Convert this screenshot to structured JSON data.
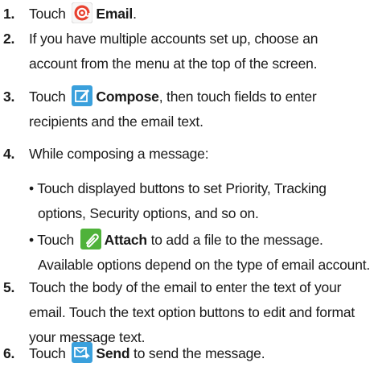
{
  "steps": [
    {
      "num": "1.",
      "pre": "Touch",
      "bold": "Email",
      "post": ".",
      "icon": "email-icon"
    },
    {
      "num": "2.",
      "line1": "If you have multiple accounts set up, choose an",
      "line2": "account from the menu at the top of the screen."
    },
    {
      "num": "3.",
      "pre": "Touch",
      "bold": "Compose",
      "post": ", then touch fields to enter",
      "line2": "recipients and the email text.",
      "icon": "compose-icon"
    },
    {
      "num": "4.",
      "line1": "While composing a message:"
    },
    {
      "num": "5.",
      "line1": "Touch the body of the email to enter the text of your",
      "line2": "email. Touch the text option buttons to edit and format",
      "line3": "your message text."
    },
    {
      "num": "6.",
      "pre": "Touch",
      "bold": "Send",
      "post": "to send the message.",
      "icon": "send-icon"
    }
  ],
  "bullets": [
    {
      "line1": "• Touch displayed buttons to set Priority, Tracking",
      "line2": "options, Security options, and so on."
    },
    {
      "pre": "• Touch",
      "bold": "Attach",
      "post": "to add a file to the message.",
      "line2": "Available options depend on the type of email account.",
      "icon": "attach-icon"
    }
  ],
  "colors": {
    "email_icon": "#e8412f",
    "compose_icon": "#3aa0dc",
    "attach_icon": "#4fb23a",
    "send_icon": "#3aa0dc"
  }
}
